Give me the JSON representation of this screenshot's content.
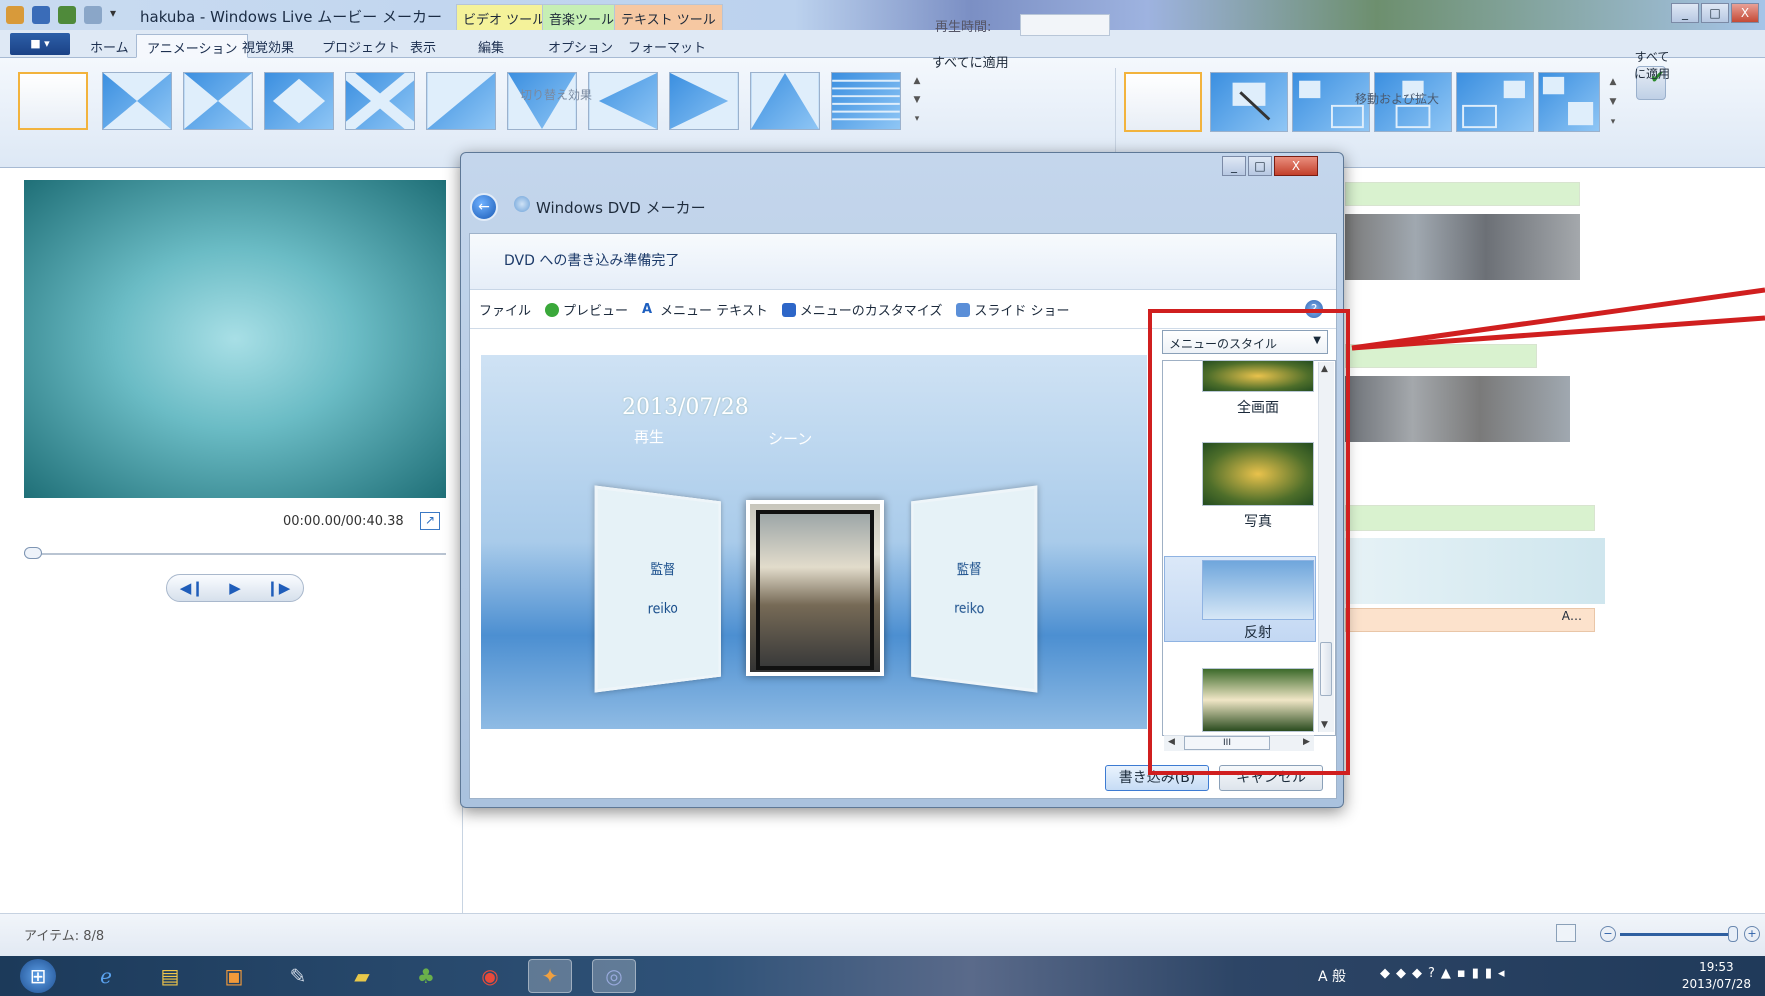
{
  "window": {
    "title": "hakuba - Windows Live ムービー メーカー",
    "min": "_",
    "max": "□",
    "close": "X"
  },
  "context_tabs": [
    {
      "label": "ビデオ ツール",
      "color": "#f4f29a"
    },
    {
      "label": "音楽ツール",
      "color": "#c6efb4"
    },
    {
      "label": "テキスト ツール",
      "color": "#f6c8a2"
    }
  ],
  "tabs": [
    "ホーム",
    "アニメーション",
    "視覚効果",
    "プロジェクト",
    "表示",
    "編集",
    "オプション",
    "フォーマット"
  ],
  "ribbon": {
    "duration_label": "再生時間:",
    "apply_all": "すべてに適用",
    "apply_all2": "すべて\nに適用",
    "group_transitions": "切り替え効果",
    "group_panzoom": "移動および拡大"
  },
  "preview": {
    "timecode": "00:00.00/00:40.38"
  },
  "status": {
    "items": "アイテム: 8/8"
  },
  "taskbar": {
    "time": "19:53",
    "date": "2013/07/28",
    "ime": "A 般"
  },
  "dialog": {
    "title": "Windows DVD メーカー",
    "heading": "DVD への書き込み準備完了",
    "toolbar": [
      "ファイル",
      "プレビュー",
      "メニュー テキスト",
      "メニューのカスタマイズ",
      "スライド ショー"
    ],
    "menu_preview": {
      "date": "2013/07/28",
      "play": "再生",
      "scene": "シーン",
      "left_title": "監督",
      "left_name": "reiko",
      "right_title": "監督",
      "right_name": "reiko"
    },
    "style_dropdown": "メニューのスタイル",
    "styles": [
      "全画面",
      "写真",
      "反射"
    ],
    "selected_style": "反射",
    "burn": "書き込み(B)",
    "cancel": "キャンセル"
  }
}
